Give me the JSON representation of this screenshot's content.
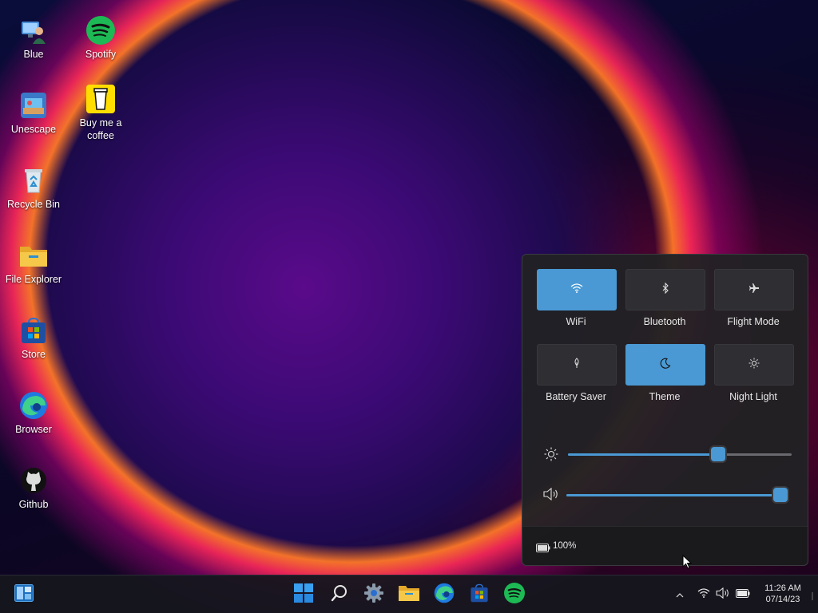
{
  "desktop": {
    "icons": [
      {
        "label": "Blue"
      },
      {
        "label": "Spotify"
      },
      {
        "label": "Unescape"
      },
      {
        "label": "Buy me a coffee"
      },
      {
        "label": "Recycle Bin"
      },
      {
        "label": "File Explorer"
      },
      {
        "label": "Store"
      },
      {
        "label": "Browser"
      },
      {
        "label": "Github"
      }
    ]
  },
  "quick_settings": {
    "tiles": [
      {
        "label": "WiFi",
        "active": true,
        "icon": "wifi-icon"
      },
      {
        "label": "Bluetooth",
        "active": false,
        "icon": "bluetooth-icon"
      },
      {
        "label": "Flight Mode",
        "active": false,
        "icon": "airplane-icon"
      },
      {
        "label": "Battery Saver",
        "active": false,
        "icon": "battery-saver-icon"
      },
      {
        "label": "Theme",
        "active": true,
        "icon": "moon-icon"
      },
      {
        "label": "Night Light",
        "active": false,
        "icon": "night-light-icon"
      }
    ],
    "brightness_level": 0.67,
    "volume_level": 1.0,
    "battery_text": "100%"
  },
  "taskbar": {
    "apps": [
      "widgets",
      "start",
      "search",
      "settings",
      "file-explorer",
      "browser",
      "store",
      "spotify"
    ],
    "clock_time": "11:26 AM",
    "clock_date": "07/14/23"
  },
  "colors": {
    "accent": "#4a99d4",
    "spotify": "#1db954"
  }
}
